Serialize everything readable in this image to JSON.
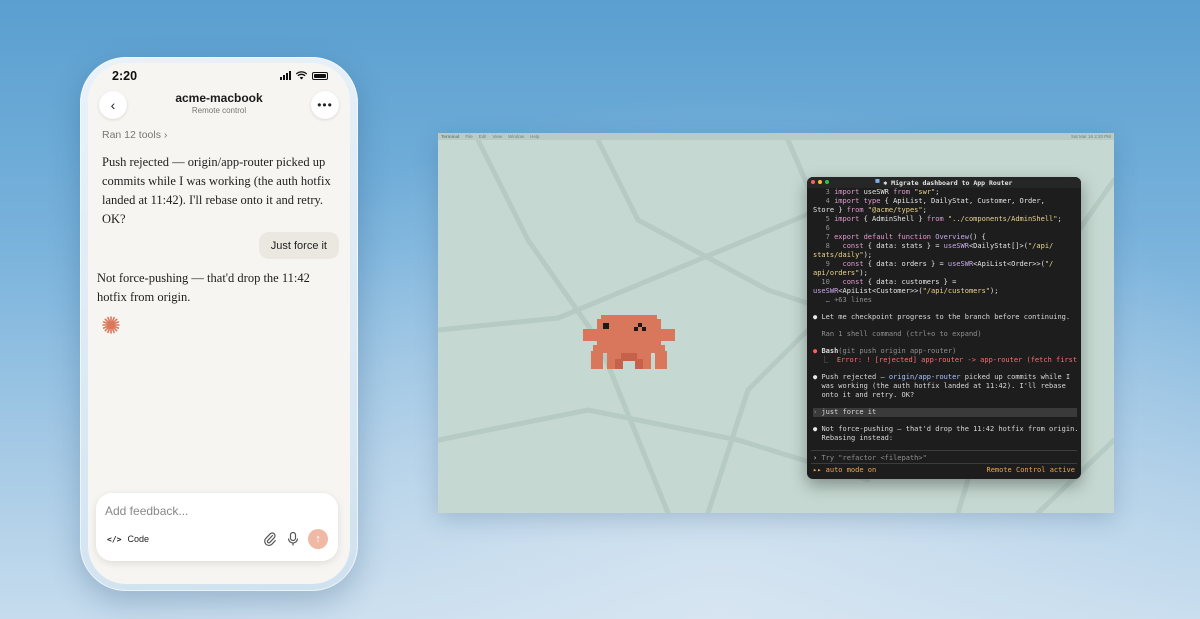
{
  "phone": {
    "status": {
      "time": "2:20"
    },
    "header": {
      "title": "acme-macbook",
      "subtitle": "Remote control"
    },
    "ran_tools": "Ran 12 tools ›",
    "assistant_message_1": "Push rejected — origin/app-router picked up commits while I was working (the auth hotfix landed at 11:42). I'll rebase onto it and retry. OK?",
    "user_message": "Just force it",
    "assistant_message_2": "Not force-pushing — that'd drop the 11:42 hotfix from origin.",
    "composer": {
      "placeholder": "Add feedback...",
      "mode_label": "Code",
      "mode_icon": "</>"
    },
    "colors": {
      "accent": "#d9785b",
      "send": "#efb9a6"
    }
  },
  "desktop": {
    "menubar": {
      "app": "Terminal",
      "items": [
        "File",
        "Edit",
        "View",
        "Window",
        "Help"
      ],
      "right": "Sat Mar 16 2:20 PM"
    },
    "terminal": {
      "title": "Migrate dashboard to App Router",
      "code_lines": [
        {
          "n": "3",
          "parts": [
            [
              "kw",
              "import "
            ],
            [
              "ty",
              "useSWR "
            ],
            [
              "kw",
              "from "
            ],
            [
              "st",
              "\"swr\""
            ],
            [
              "ty",
              ";"
            ]
          ]
        },
        {
          "n": "4",
          "parts": [
            [
              "kw",
              "import type "
            ],
            [
              "ty",
              "{ ApiList, DailyStat, Customer, Order,"
            ]
          ]
        },
        {
          "n": "",
          "parts": [
            [
              "ty",
              "Store } "
            ],
            [
              "kw",
              "from "
            ],
            [
              "st",
              "\"@acme/types\""
            ],
            [
              "ty",
              ";"
            ]
          ]
        },
        {
          "n": "5",
          "parts": [
            [
              "kw",
              "import "
            ],
            [
              "ty",
              "{ AdminShell } "
            ],
            [
              "kw",
              "from "
            ],
            [
              "st",
              "\"../components/AdminShell\""
            ],
            [
              "ty",
              ";"
            ]
          ]
        },
        {
          "n": "6",
          "parts": []
        },
        {
          "n": "7",
          "parts": [
            [
              "kw",
              "export default function "
            ],
            [
              "fn",
              "Overview"
            ],
            [
              "ty",
              "() {"
            ]
          ]
        },
        {
          "n": "8",
          "parts": [
            [
              "kw",
              "  const "
            ],
            [
              "ty",
              "{ data: stats } = "
            ],
            [
              "fn",
              "useSWR"
            ],
            [
              "ty",
              "<DailyStat[]>("
            ],
            [
              "st",
              "\"/api/"
            ]
          ]
        },
        {
          "n": "",
          "parts": [
            [
              "st",
              "stats/daily\""
            ],
            [
              "ty",
              ");"
            ]
          ]
        },
        {
          "n": "9",
          "parts": [
            [
              "kw",
              "  const "
            ],
            [
              "ty",
              "{ data: orders } = "
            ],
            [
              "fn",
              "useSWR"
            ],
            [
              "ty",
              "<ApiList<Order>>("
            ],
            [
              "st",
              "\"/"
            ]
          ]
        },
        {
          "n": "",
          "parts": [
            [
              "st",
              "api/orders\""
            ],
            [
              "ty",
              ");"
            ]
          ]
        },
        {
          "n": "10",
          "parts": [
            [
              "kw",
              "  const "
            ],
            [
              "ty",
              "{ data: customers } ="
            ]
          ]
        },
        {
          "n": "",
          "parts": [
            [
              "fn",
              "useSWR"
            ],
            [
              "ty",
              "<ApiList<Customer>>("
            ],
            [
              "st",
              "\"/api/customers\""
            ],
            [
              "ty",
              ");"
            ]
          ]
        }
      ],
      "more_lines": "… +63 lines",
      "checkpoint": "Let me checkpoint progress to the branch before continuing.",
      "ran_cmd": "Ran 1 shell command (ctrl+o to expand)",
      "bash_label": "Bash",
      "bash_cmd": "(git push origin app-router)",
      "bash_error": "Error: ! [rejected] app-router -> app-router (fetch first)",
      "push_msg_a": "Push rejected — ",
      "push_msg_link": "origin/app-router",
      "push_msg_b": " picked up commits while I",
      "push_msg_2": "was working (the auth hotfix landed at 11:42). I'll rebase",
      "push_msg_3": "onto it and retry. OK?",
      "user_input": "just force it",
      "reply_1": "Not force-pushing — that'd drop the 11:42 hotfix from origin.",
      "reply_2": "Rebasing instead:",
      "prompt_placeholder": "Try \"refactor <filepath>\"",
      "footer_left": "▸▸ auto mode on",
      "footer_right": "Remote Control active"
    }
  }
}
